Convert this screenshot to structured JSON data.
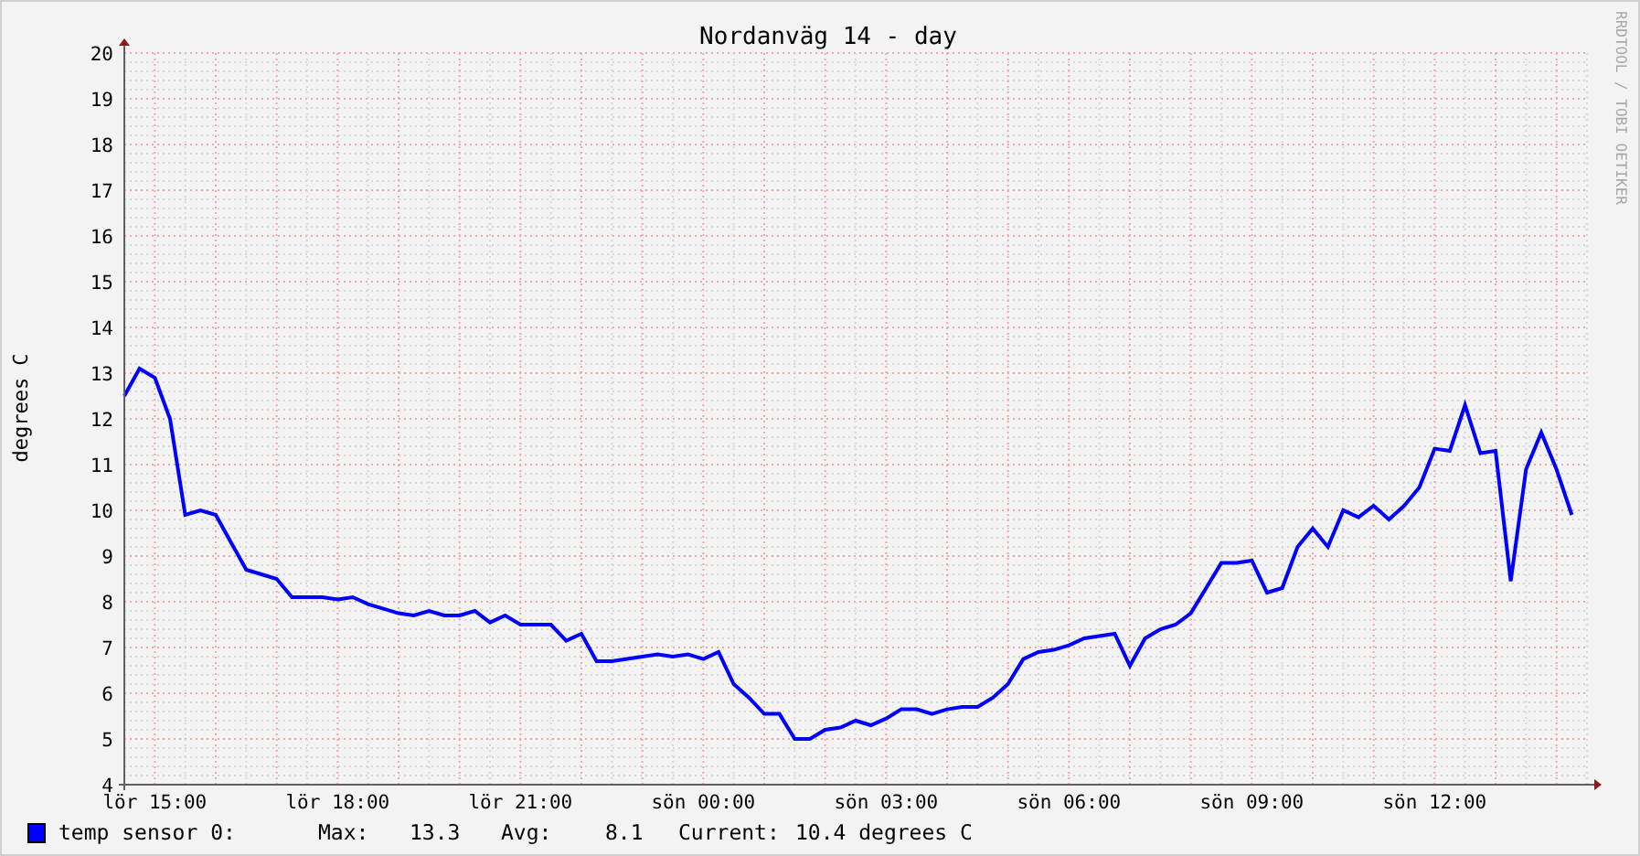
{
  "signature": "RRDTOOL / TOBI OETIKER",
  "chart_data": {
    "type": "line",
    "title": "Nordanväg 14 - day",
    "ylabel": "degrees C",
    "grid": true,
    "ylim": [
      4,
      20
    ],
    "yticks": [
      4,
      5,
      6,
      7,
      8,
      9,
      10,
      11,
      12,
      13,
      14,
      15,
      16,
      17,
      18,
      19,
      20
    ],
    "categories": [
      null,
      null,
      "lör 15:00",
      null,
      null,
      null,
      null,
      null,
      null,
      null,
      null,
      null,
      null,
      null,
      "lör 18:00",
      null,
      null,
      null,
      null,
      null,
      null,
      null,
      null,
      null,
      null,
      null,
      "lör 21:00",
      null,
      null,
      null,
      null,
      null,
      null,
      null,
      null,
      null,
      null,
      null,
      "sön 00:00",
      null,
      null,
      null,
      null,
      null,
      null,
      null,
      null,
      null,
      null,
      null,
      "sön 03:00",
      null,
      null,
      null,
      null,
      null,
      null,
      null,
      null,
      null,
      null,
      null,
      "sön 06:00",
      null,
      null,
      null,
      null,
      null,
      null,
      null,
      null,
      null,
      null,
      null,
      "sön 09:00",
      null,
      null,
      null,
      null,
      null,
      null,
      null,
      null,
      null,
      null,
      null,
      "sön 12:00",
      null,
      null,
      null,
      null,
      null,
      null,
      null,
      null,
      null
    ],
    "series": [
      {
        "color": "#0000ff",
        "values": [
          12.5,
          13.1,
          12.9,
          12.0,
          9.9,
          10.0,
          9.9,
          9.3,
          8.7,
          8.6,
          8.5,
          8.1,
          8.1,
          8.1,
          8.05,
          8.1,
          7.95,
          7.85,
          7.75,
          7.7,
          7.8,
          7.7,
          7.7,
          7.8,
          7.55,
          7.7,
          7.5,
          7.5,
          7.5,
          7.15,
          7.3,
          6.7,
          6.7,
          6.75,
          6.8,
          6.85,
          6.8,
          6.85,
          6.75,
          6.9,
          6.2,
          5.9,
          5.55,
          5.55,
          5.0,
          5.0,
          5.2,
          5.25,
          5.4,
          5.3,
          5.45,
          5.65,
          5.65,
          5.55,
          5.65,
          5.7,
          5.7,
          5.9,
          6.2,
          6.75,
          6.9,
          6.95,
          7.05,
          7.2,
          7.25,
          7.3,
          6.6,
          7.2,
          7.4,
          7.5,
          7.75,
          8.3,
          8.85,
          8.85,
          8.9,
          8.2,
          8.3,
          9.2,
          9.6,
          9.2,
          10.0,
          9.85,
          10.1,
          9.8,
          10.1,
          10.5,
          11.35,
          11.3,
          12.3,
          11.25,
          11.3,
          8.45,
          10.9,
          11.7,
          10.9,
          9.9
        ]
      }
    ]
  },
  "legend": {
    "color": "#0000ff",
    "label": "temp sensor 0:",
    "max_label": "Max:",
    "max": "13.3",
    "avg_label": "Avg:",
    "avg": "8.1",
    "current_label": "Current:",
    "current": "10.4 degrees C"
  }
}
